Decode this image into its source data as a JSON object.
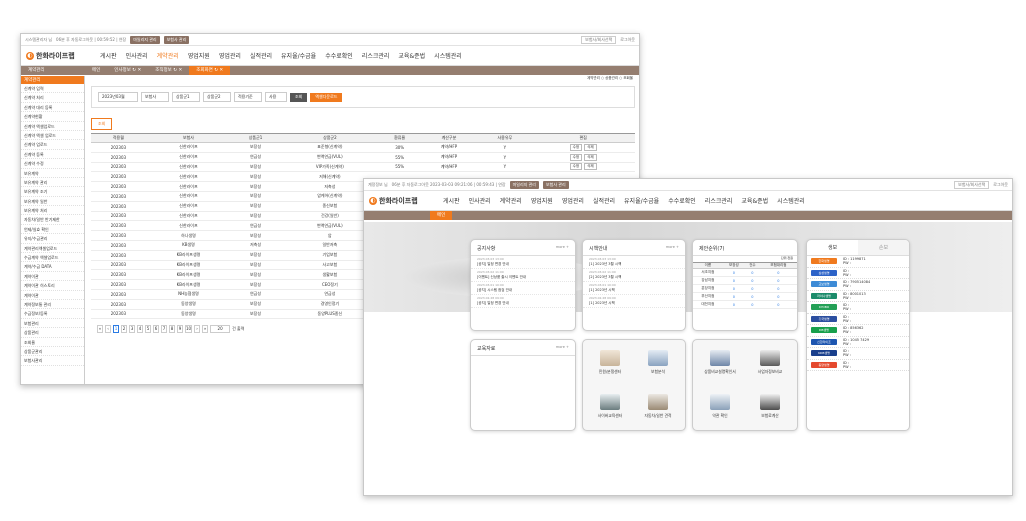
{
  "w1": {
    "top_left": "시스템관리자 님",
    "top_info": "06분 후 자동로그아웃 | 00:59:52 | 연장",
    "pills": [
      "마일리지 관리",
      "보험사 관리"
    ],
    "top_right_select": "보험사/회사선택",
    "logout": "로그아웃",
    "logo": "한화라이프랩",
    "menus": [
      "게시판",
      "인사관리",
      "계약관리",
      "영업지원",
      "영업관리",
      "실적관리",
      "유지율/수금율",
      "수수료확인",
      "리스크관리",
      "교육&준법",
      "시스템관리"
    ],
    "active_menu": "계약관리",
    "tabs": [
      "메인",
      "인사정보",
      "조직정보",
      "조회화면"
    ],
    "sidebar_header": "계약관리",
    "sidebar_items": [
      "신계약 입력",
      "신계약 처리",
      "신계약 대리 등록",
      "신계약현황",
      "신계약 엑셀업로드",
      "신계약 엑셀 업로드",
      "신계약 업로드",
      "신계약 등록",
      "신계약 수정",
      "보유계약",
      "보유계약 관리",
      "보유계약 조기",
      "보유계약 일반",
      "보유계약 처리",
      "자동차/일반 반기제한",
      "언제/실효 확인",
      "유지/수금관리",
      "계약관리엑셀업로드",
      "수금계약 엑셀업로드",
      "계약/수금 DATA",
      "계약이관",
      "계약이관 히스토리",
      "계약이관",
      "계약정보통 관리",
      "수금정보/등록",
      "보험관리",
      "상품관리",
      "조회율",
      "상품군관리",
      "보험사관리"
    ],
    "filters": [
      "2023년03월",
      "보험사",
      "상품군1",
      "상품군2",
      "적용기준",
      "사용"
    ],
    "search_btn": "조회",
    "excel_btn": "엑셀다운로드",
    "radio_labels": [
      "계약관리",
      "상품관리",
      "조회율"
    ],
    "section_tab": "조회",
    "columns": [
      "적용월",
      "보험사",
      "상품군1",
      "상품군2",
      "환류율",
      "계산구분",
      "사용유무",
      "편집"
    ],
    "rows": [
      [
        "202303",
        "신한라이프",
        "보장성",
        "표준형(신계약)",
        "30%",
        "계약/HFP",
        "Y"
      ],
      [
        "202303",
        "신한라이프",
        "연금성",
        "변액연금(VUL)",
        "55%",
        "계약/HFP",
        "Y"
      ],
      [
        "202303",
        "신한라이프",
        "보장성",
        "VIP가족(신계약)",
        "55%",
        "계약/HFP",
        "Y"
      ],
      [
        "202303",
        "신한라이프",
        "보장성",
        "저해(신계약)",
        "",
        "",
        ""
      ],
      [
        "202303",
        "신한라이프",
        "보장성",
        "저축성",
        "",
        "",
        ""
      ],
      [
        "202303",
        "신한라이프",
        "보장성",
        "암케어(신계약)",
        "",
        "",
        ""
      ],
      [
        "202303",
        "신한라이프",
        "보장성",
        "종신보험",
        "",
        "",
        ""
      ],
      [
        "202303",
        "신한라이프",
        "보장성",
        "건강(일반)",
        "",
        "",
        ""
      ],
      [
        "202303",
        "신한라이프",
        "연금성",
        "변액연금(VUL)",
        "",
        "",
        ""
      ],
      [
        "202303",
        "하나생명",
        "보장성",
        "암",
        "",
        "",
        ""
      ],
      [
        "202303",
        "KB생명",
        "저축성",
        "일반저축",
        "",
        "",
        ""
      ],
      [
        "202303",
        "KB라이프생명",
        "보장성",
        "기업보험",
        "",
        "",
        ""
      ],
      [
        "202303",
        "KB라이프생명",
        "보장성",
        "사고보험",
        "",
        "",
        ""
      ],
      [
        "202303",
        "KB라이프생명",
        "보장성",
        "생활보험",
        "",
        "",
        ""
      ],
      [
        "202303",
        "KB라이프생명",
        "보장성",
        "CEO정기",
        "",
        "",
        ""
      ],
      [
        "202303",
        "NH농협생명",
        "연금성",
        "연금성",
        "",
        "",
        ""
      ],
      [
        "202303",
        "동양생명",
        "보장성",
        "경영인정기",
        "",
        "",
        ""
      ],
      [
        "202303",
        "동양생명",
        "보장성",
        "동양PLUS종신",
        "",
        "",
        ""
      ]
    ],
    "edit_btn": "수정",
    "del_btn": "삭제",
    "pages": [
      "1",
      "2",
      "3",
      "4",
      "5",
      "6",
      "7",
      "8",
      "9",
      "10"
    ],
    "page_size": "20",
    "page_total": "건 출력"
  },
  "w2": {
    "top_left": "계정정보 님",
    "top_info": "06분 후 자동로그아웃 2023-03-03 09:21:06 | 00:59:43 | 연장",
    "pills": [
      "마일리지 관리",
      "보험사 관리"
    ],
    "top_right_select": "보험사/회사선택",
    "logout": "로그아웃",
    "logo": "한화라이프랩",
    "menus": [
      "게시판",
      "인사관리",
      "계약관리",
      "영업지원",
      "영업관리",
      "실적관리",
      "유지율/수금율",
      "수수료확인",
      "리스크관리",
      "교육&준법",
      "시스템관리"
    ],
    "tab": "메인",
    "notice": {
      "title": "공지사항",
      "more": "more +",
      "items": [
        {
          "date": "2023.03.03 13:00",
          "text": "[공지] 일정 변경 안내"
        },
        {
          "date": "2023.03.02 11:00",
          "text": "[이벤트] 신상품 출시 이벤트 안내"
        },
        {
          "date": "2023.03.01 10:00",
          "text": "[공지] 시스템 점검 안내"
        },
        {
          "date": "2023.02.28 09:00",
          "text": "[공지] 일정 변경 안내"
        }
      ]
    },
    "schedule": {
      "title": "시책안내",
      "more": "more +",
      "items": [
        {
          "date": "2023.03.03 13:00",
          "text": "[1] 2023년 3월 시책"
        },
        {
          "date": "2023.03.02 11:00",
          "text": "[2] 2023년 3월 시책"
        },
        {
          "date": "2023.03.01 10:00",
          "text": "[1] 2023년 시책"
        },
        {
          "date": "2023.02.28 09:00",
          "text": "[1] 2023년 시책"
        }
      ]
    },
    "perf": {
      "title": "제안순위(7)",
      "sub": "단위:천원",
      "cols": [
        "이름",
        "보장성",
        "건수",
        "보험대리점"
      ],
      "rows": [
        [
          "서초지점",
          "0",
          "0",
          "0"
        ],
        [
          "강남지점",
          "0",
          "0",
          "0"
        ],
        [
          "분당지점",
          "0",
          "0",
          "0"
        ],
        [
          "부산지점",
          "0",
          "0",
          "0"
        ],
        [
          "대전지점",
          "0",
          "0",
          "0"
        ]
      ]
    },
    "pds": {
      "title": "교육자료",
      "more": "more +"
    },
    "quick1": [
      "민원/분쟁센터",
      "보험분석"
    ],
    "quick2": [
      "사이버교육센터",
      "자동차/일반 견적"
    ],
    "quick3": [
      "상품비교설명확인서",
      "사업자정보비교"
    ],
    "quick4": [
      "약관 확인",
      "보험료계산"
    ],
    "ins": {
      "tabs": [
        "생보",
        "손보"
      ],
      "items": [
        {
          "name": "한화생명",
          "color": "#f07a1e",
          "id": "ID : 1199871",
          "pw": "PW :"
        },
        {
          "name": "삼성생명",
          "color": "#2d63c8",
          "id": "ID :",
          "pw": "PW :"
        },
        {
          "name": "교보생명",
          "color": "#3d8bd6",
          "id": "ID : 790514084",
          "pw": "PW :"
        },
        {
          "name": "라이나생명",
          "color": "#1c8c6b",
          "id": "ID : 8001013",
          "pw": "PW :"
        },
        {
          "name": "KYOBO",
          "color": "#24a056",
          "id": "ID :",
          "pw": "PW :"
        },
        {
          "name": "흥국생명",
          "color": "#2c4fa0",
          "id": "ID :",
          "pw": "PW :"
        },
        {
          "name": "DB생명",
          "color": "#18a04c",
          "id": "ID : 856362",
          "pw": "PW :"
        },
        {
          "name": "신한라이프",
          "color": "#1e56b0",
          "id": "ID : 1045 7429",
          "pw": "PW :"
        },
        {
          "name": "KDB생명",
          "color": "#1a3f8c",
          "id": "ID :",
          "pw": "PW :"
        },
        {
          "name": "동양생명",
          "color": "#e5492e",
          "id": "ID :",
          "pw": "PW :"
        }
      ]
    }
  }
}
